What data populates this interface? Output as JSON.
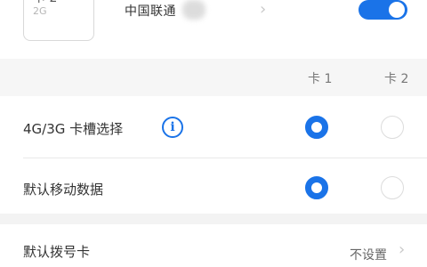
{
  "sim": {
    "card_name": "卡 2",
    "card_type": "2G",
    "carrier": "中国联通",
    "enabled": true
  },
  "table": {
    "col1": "卡 1",
    "col2": "卡 2"
  },
  "rows": [
    {
      "label": "4G/3G 卡槽选择",
      "selected": "卡 1"
    },
    {
      "label": "默认移动数据",
      "selected": "卡 1"
    }
  ],
  "default_dial": {
    "label": "默认拨号卡",
    "value": "不设置"
  },
  "colors": {
    "accent": "#1a73e8",
    "band": "#f6f6f6"
  },
  "icons": {
    "info": "info-icon",
    "chevron": "chevron-right-icon"
  }
}
